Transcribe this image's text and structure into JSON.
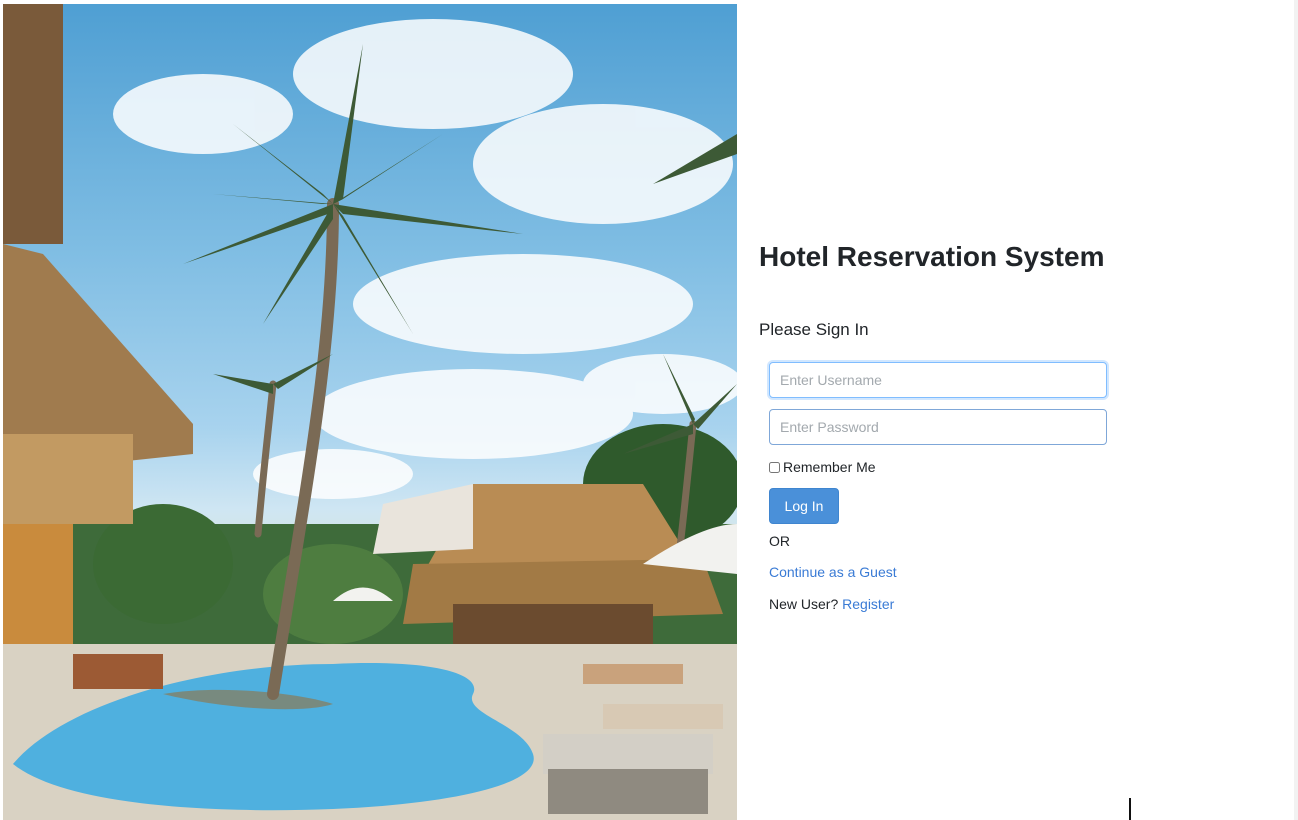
{
  "hero": {
    "image_alt": "Tropical resort pool with palm trees and thatched cabanas"
  },
  "app": {
    "title": "Hotel Reservation System"
  },
  "login": {
    "heading": "Please Sign In",
    "username_placeholder": "Enter Username",
    "password_placeholder": "Enter Password",
    "remember_label": "Remember Me",
    "submit_label": "Log In",
    "or_label": "OR",
    "guest_label": "Continue as a Guest",
    "new_user_prompt": "New User?",
    "register_label": "Register"
  },
  "colors": {
    "primary_button": "#4a90d9",
    "link": "#3a7bd5",
    "input_focus_border": "#80bdff"
  }
}
